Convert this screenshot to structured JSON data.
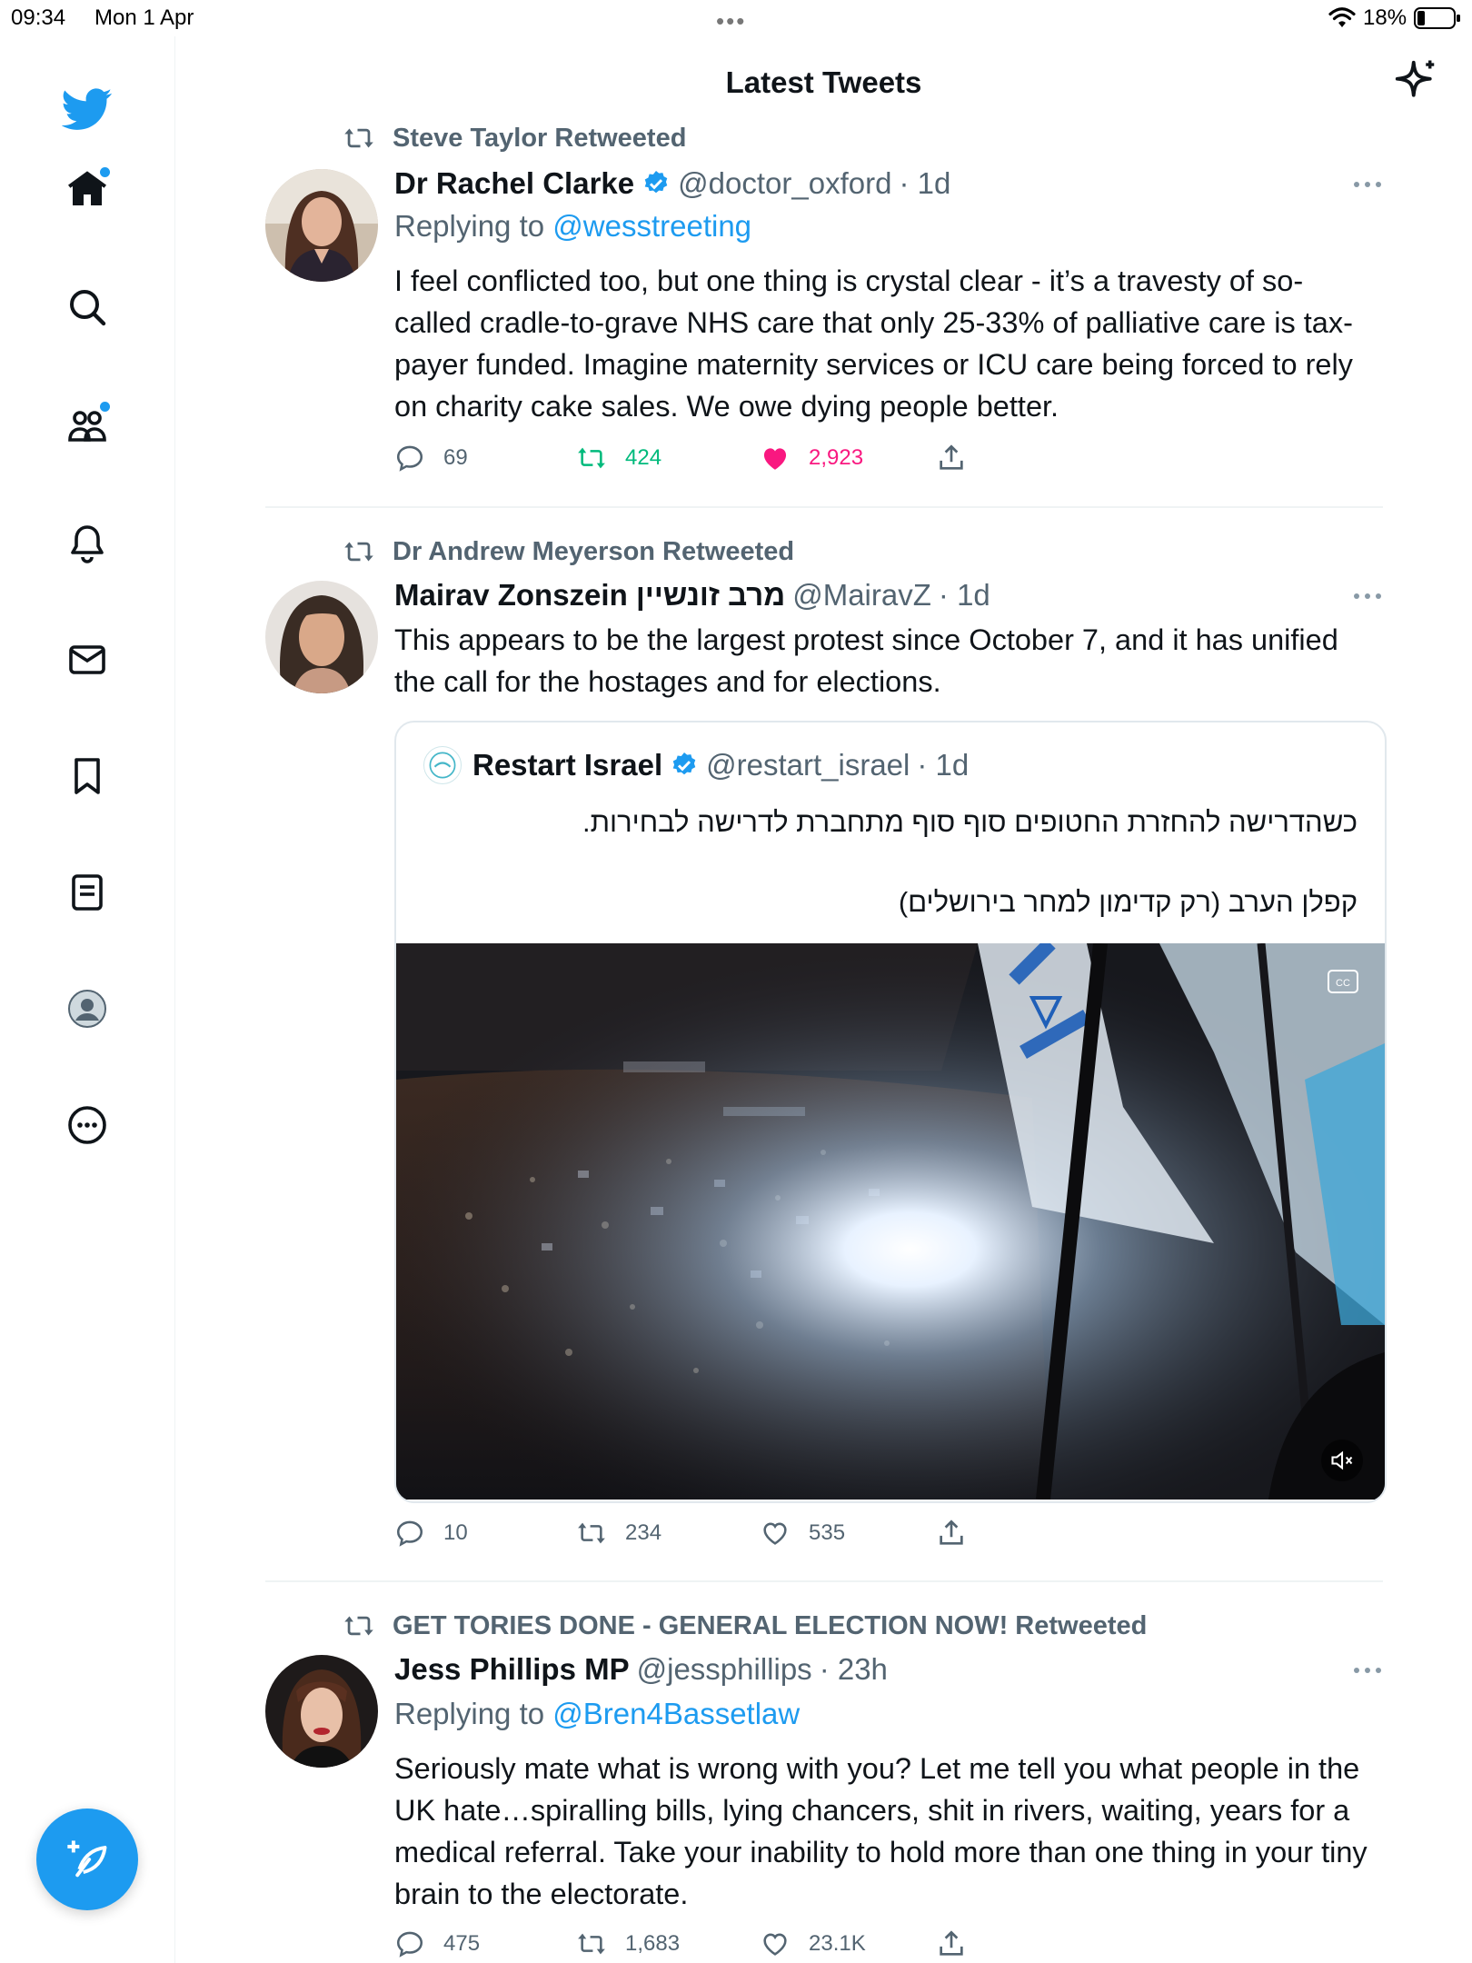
{
  "status_bar": {
    "time": "09:34",
    "date": "Mon 1 Apr",
    "battery": "18%"
  },
  "header": {
    "title": "Latest Tweets"
  },
  "colors": {
    "accent": "#1d9bf0",
    "retweet_green": "#00ba7c",
    "like_pink": "#f91880",
    "muted": "#536471"
  },
  "sidebar": {
    "items": [
      {
        "icon": "twitter-bird-icon"
      },
      {
        "icon": "home-icon"
      },
      {
        "icon": "search-icon"
      },
      {
        "icon": "communities-icon"
      },
      {
        "icon": "bell-icon"
      },
      {
        "icon": "mail-icon"
      },
      {
        "icon": "bookmark-icon"
      },
      {
        "icon": "lists-icon"
      },
      {
        "icon": "profile-icon"
      },
      {
        "icon": "more-icon"
      }
    ],
    "compose_icon": "compose-tweet-icon"
  },
  "tweets": [
    {
      "retweeted_by": "Steve Taylor Retweeted",
      "name": "Dr Rachel Clarke",
      "verified": true,
      "handle": "@doctor_oxford",
      "time": "· 1d",
      "replying_prefix": "Replying to ",
      "replying_to": "@wesstreeting",
      "text": "I feel conflicted too, but one thing is crystal clear - it’s a travesty of so-called cradle-to-grave NHS care that only 25-33% of palliative care is tax-payer funded. Imagine maternity services or ICU care being forced to rely on charity cake sales. We owe dying people better.",
      "replies": "69",
      "retweets": "424",
      "likes": "2,923",
      "retweeted": true,
      "liked": true
    },
    {
      "retweeted_by": "Dr Andrew Meyerson Retweeted",
      "name": "Mairav Zonszein מרב זונשיין",
      "verified": false,
      "handle": "@MairavZ",
      "time": "· 1d",
      "text": "This appears to be the largest protest since October 7, and it has unified the call for the hostages and for elections.",
      "quote": {
        "name": "Restart Israel",
        "verified": true,
        "handle": "@restart_israel",
        "time": "· 1d",
        "line1": "כשהדרישה להחזרת החטופים סוף סוף מתחברת לדרישה לבחירות.",
        "line2": "קפלן הערב (רק קדימון למחר בירושלים)"
      },
      "replies": "10",
      "retweets": "234",
      "likes": "535"
    },
    {
      "retweeted_by": "GET TORIES DONE - GENERAL ELECTION NOW! Retweeted",
      "name": "Jess Phillips MP",
      "verified": false,
      "handle": "@jessphillips",
      "time": "· 23h",
      "replying_prefix": "Replying to ",
      "replying_to": "@Bren4Bassetlaw",
      "text": "Seriously mate what is wrong with you? Let me tell you what people in the UK hate…spiralling bills, lying chancers, shit in rivers, waiting, years for a medical referral. Take your inability to hold more than one thing in your tiny brain to the electorate.",
      "replies": "475",
      "retweets": "1,683",
      "likes": "23.1K"
    }
  ]
}
